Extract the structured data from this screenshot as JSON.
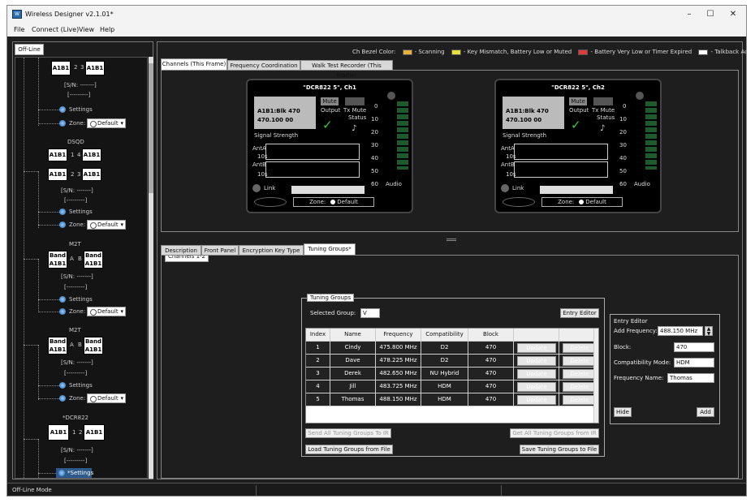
{
  "window": {
    "title": "Wireless Designer v2.1.01*",
    "minimize": "–",
    "maximize": "☐",
    "close": "✕"
  },
  "menu": [
    "File",
    "Connect (Live)",
    "View",
    "Help"
  ],
  "left": {
    "tab": "Off-Line",
    "devices": [
      {
        "name": "",
        "slots": [
          "A1B1",
          "2",
          "3",
          "A1B1"
        ],
        "serial": "[S/N: -------]",
        "dashes": "[---------]",
        "settings": "Settings",
        "zone_label": "Zone:",
        "zone": "Default"
      },
      {
        "name": "DSQD",
        "slots": [
          "A1B1",
          "1",
          "4",
          "A1B1",
          "A1B1",
          "2",
          "3",
          "A1B1"
        ],
        "serial": "[S/N: -------]",
        "dashes": "[---------]",
        "settings": "Settings",
        "zone_label": "Zone:",
        "zone": "Default"
      },
      {
        "name": "M2T",
        "slots": [
          "Band",
          "A1B1",
          "A",
          "B",
          "Band",
          "A1B1"
        ],
        "serial": "[S/N: -------]",
        "dashes": "[---------]",
        "settings": "Settings",
        "zone_label": "Zone:",
        "zone": "Default"
      },
      {
        "name": "M2T",
        "slots": [
          "Band",
          "A1B1",
          "A",
          "B",
          "Band",
          "A1B1"
        ],
        "serial": "[S/N: -------]",
        "dashes": "[---------]",
        "settings": "Settings",
        "zone_label": "Zone:",
        "zone": "Default"
      },
      {
        "name": "*DCR822",
        "slots": [
          "A1B1",
          "1",
          "2",
          "A1B1"
        ],
        "serial": "[S/N: -------]",
        "dashes": "[---------]",
        "settings": "*Settings"
      }
    ]
  },
  "legend": {
    "label": "Ch Bezel Color:",
    "items": [
      {
        "text": "- Scanning",
        "color": "#e8b23a"
      },
      {
        "text": "- Key Mismatch, Battery Low or Muted",
        "color": "#e8e03a"
      },
      {
        "text": "- Battery Very Low or Timer Expired",
        "color": "#e03a3a"
      },
      {
        "text": "- Talkback Active",
        "color": "#ffffff"
      }
    ]
  },
  "top_tabs": [
    "Channels (This Frame)",
    "Frequency Coordination",
    "Walk Test Recorder (This Frame)"
  ],
  "channels_tab": "Channels 1-2",
  "channels": [
    {
      "name": "\"DCR822 5\", Ch1",
      "lcd1": "A1B1:Blk 470",
      "lcd2": "470.100    00",
      "mute": "Mute",
      "output": "Output",
      "tx1": "Tx Mute",
      "tx2": "Status",
      "signal": "Signal Strength",
      "anta": "AntA",
      "antb": "AntB",
      "s10a": "10s",
      "s10b": "10s",
      "link": "Link",
      "audio": "Audio",
      "zone_label": "Zone:",
      "zone": "Default",
      "scale": [
        "0",
        "10",
        "20",
        "30",
        "40",
        "50",
        "60"
      ]
    },
    {
      "name": "\"DCR822 5\", Ch2",
      "lcd1": "A1B1:Blk 470",
      "lcd2": "470.100    00",
      "mute": "Mute",
      "output": "Output",
      "tx1": "Tx Mute",
      "tx2": "Status",
      "signal": "Signal Strength",
      "anta": "AntA",
      "antb": "AntB",
      "s10a": "10s",
      "s10b": "10s",
      "link": "Link",
      "audio": "Audio",
      "zone_label": "Zone:",
      "zone": "Default",
      "scale": [
        "0",
        "10",
        "20",
        "30",
        "40",
        "50",
        "60"
      ]
    }
  ],
  "bottom_tabs": [
    "Description",
    "Front Panel",
    "Encryption Key Type",
    "Tuning Groups*"
  ],
  "tuning": {
    "title": "Tuning Groups",
    "selected_label": "Selected Group:",
    "selected": "V",
    "entry_editor_btn": "Entry Editor",
    "headers": [
      "Index",
      "Name",
      "Frequency",
      "Compatibility",
      "Block",
      "",
      ""
    ],
    "rows": [
      [
        "1",
        "Cindy",
        "475.800 MHz",
        "D2",
        "470",
        "Update",
        "Delete"
      ],
      [
        "2",
        "Dave",
        "478.225 MHz",
        "D2",
        "470",
        "Update",
        "Delete"
      ],
      [
        "3",
        "Derek",
        "482.650 MHz",
        "NU Hybrid",
        "470",
        "Update",
        "Delete"
      ],
      [
        "4",
        "Jill",
        "483.725 MHz",
        "HDM",
        "470",
        "Update",
        "Delete"
      ],
      [
        "5",
        "Thomas",
        "488.150 MHz",
        "HDM",
        "470",
        "Update",
        "Delete"
      ]
    ],
    "send_all": "Send All Tuning Groups To IR",
    "get_all": "Get All Tuning Groups from IR",
    "load": "Load Tuning Groups from File",
    "save": "Save Tuning Groups to File"
  },
  "editor": {
    "title": "Entry Editor",
    "add_freq_label": "Add Frequency:",
    "add_freq": "488.150 MHz",
    "block_label": "Block:",
    "block": "470",
    "compat_label": "Compatibility Mode:",
    "compat": "HDM",
    "freq_name_label": "Frequency Name:",
    "freq_name": "Thomas",
    "hide": "Hide",
    "add": "Add"
  },
  "status": {
    "mode": "Off-Line Mode"
  }
}
